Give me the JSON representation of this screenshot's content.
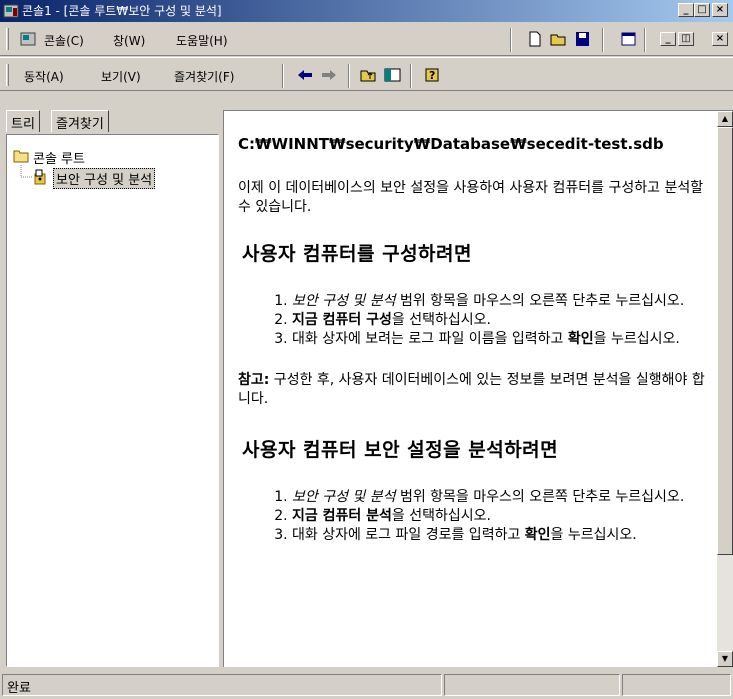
{
  "window": {
    "title": "콘솔1 - [콘솔 루트₩보안 구성 및 분석]",
    "controls": {
      "minimize": "_",
      "maximize": "□",
      "close": "×"
    }
  },
  "menubar": {
    "console": "콘솔(C)",
    "window": "창(W)",
    "help": "도움말(H)"
  },
  "toolbar": {
    "action": "동작(A)",
    "view": "보기(V)",
    "favorites": "즐겨찾기(F)"
  },
  "left_tabs": [
    "트리",
    "즐겨찾기"
  ],
  "tree": {
    "root": "콘솔 루트",
    "child": "보안 구성 및 분석"
  },
  "content": {
    "path": "C:₩WINNT₩security₩Database₩secedit-test.sdb",
    "intro": "이제 이 데이터베이스의 보안 설정을 사용하여 사용자 컴퓨터를 구성하고 분석할 수 있습니다.",
    "section1_title": "사용자 컴퓨터를 구성하려면",
    "section1_steps": [
      {
        "em": "보안 구성 및 분석",
        "text": " 범위 항목을 마우스의 오른쪽 단추로 누르십시오."
      },
      {
        "strong": "지금 컴퓨터 구성",
        "text": "을 선택하십시오."
      },
      {
        "pre": "대화 상자에 보려는 로그 파일 이름을 입력하고 ",
        "strong": "확인",
        "text": "을 누르십시오."
      }
    ],
    "note_label": "참고:",
    "note_text": " 구성한 후, 사용자 데이터베이스에 있는 정보를 보려면 분석을 실행해야 합니다.",
    "section2_title": "사용자 컴퓨터 보안 설정을 분석하려면",
    "section2_steps": [
      {
        "em": "보안 구성 및 분석",
        "text": " 범위 항목을 마우스의 오른쪽 단추로 누르십시오."
      },
      {
        "strong": "지금 컴퓨터 분석",
        "text": "을 선택하십시오."
      },
      {
        "pre": "대화 상자에 로그 파일 경로를 입력하고 ",
        "strong": "확인",
        "text": "을 누르십시오."
      }
    ]
  },
  "statusbar": {
    "text": "완료"
  },
  "colors": {
    "title_start": "#0a246a",
    "title_end": "#a6caf0",
    "face": "#d4d0c8"
  }
}
